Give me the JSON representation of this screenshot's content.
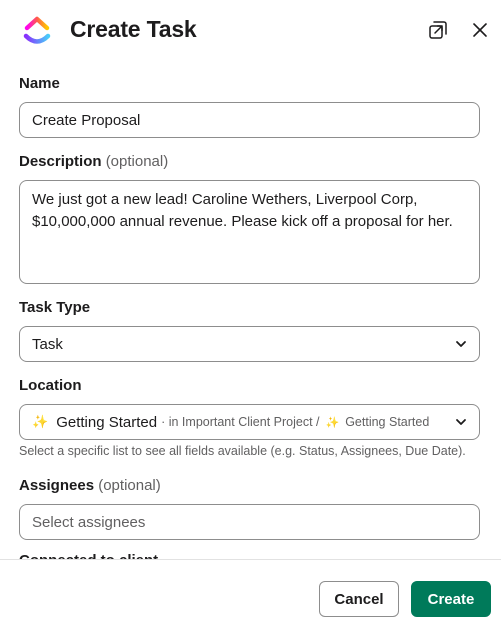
{
  "header": {
    "title": "Create Task",
    "logo_icon": "clickup-logo-icon",
    "popout_icon": "open-in-window-icon",
    "close_icon": "close-icon"
  },
  "form": {
    "name": {
      "label": "Name",
      "value": "Create Proposal"
    },
    "description": {
      "label": "Description",
      "optional": "(optional)",
      "value": "We just got a new lead! Caroline Wethers, Liverpool Corp, $10,000,000 annual revenue. Please kick off a proposal for her."
    },
    "task_type": {
      "label": "Task Type",
      "value": "Task"
    },
    "location": {
      "label": "Location",
      "list": "Getting Started",
      "context": "· in Important Client Project /",
      "sub_list": "Getting Started",
      "hint": "Select a specific list to see all fields available (e.g. Status, Assignees, Due Date)."
    },
    "assignees": {
      "label": "Assignees",
      "optional": "(optional)",
      "placeholder": "Select assignees"
    },
    "next_label_partial": "Connected to client"
  },
  "footer": {
    "cancel_label": "Cancel",
    "create_label": "Create"
  },
  "colors": {
    "primary": "#007a5a",
    "border": "#8d8d8d",
    "muted_text": "#616061",
    "logo_pink": "#fa12e3",
    "logo_purple": "#7b68ee",
    "logo_orange": "#ff9816",
    "logo_blue": "#49ccf9"
  }
}
